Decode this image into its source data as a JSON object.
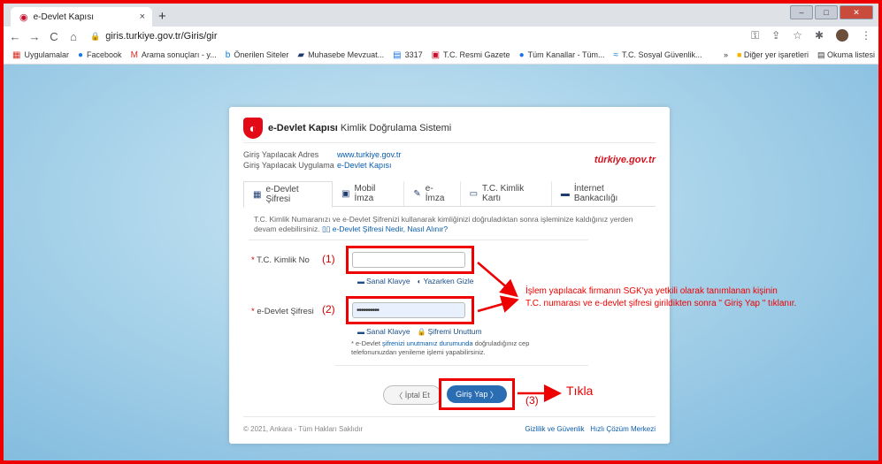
{
  "browser": {
    "tab_title": "e-Devlet Kapısı",
    "tab_close": "×",
    "new_tab": "+",
    "url": "giris.turkiye.gov.tr/Giris/gir",
    "nav": {
      "back": "←",
      "forward": "→",
      "reload": "C",
      "home": "⌂"
    }
  },
  "bookmarks": {
    "items": [
      {
        "label": "Uygulamalar",
        "icon": "apps-icon"
      },
      {
        "label": "Facebook",
        "icon": "facebook-icon"
      },
      {
        "label": "Arama sonuçları - y...",
        "icon": "gmail-icon"
      },
      {
        "label": "Önerilen Siteler",
        "icon": "bing-icon"
      },
      {
        "label": "Muhasebe Mevzuat...",
        "icon": "mm-icon"
      },
      {
        "label": "3317",
        "icon": "doc-icon"
      },
      {
        "label": "T.C. Resmi Gazete",
        "icon": "gazette-icon"
      },
      {
        "label": "Tüm Kanallar - Tüm...",
        "icon": "channel-icon"
      },
      {
        "label": "T.C. Sosyal Güvenlik...",
        "icon": "sgk-icon"
      }
    ],
    "more": "»",
    "other": "Diğer yer işaretleri",
    "reading": "Okuma listesi"
  },
  "card": {
    "header_bold": "e-Devlet Kapısı",
    "header_rest": " Kimlik Doğrulama Sistemi",
    "info": [
      {
        "label": "Giriş Yapılacak Adres",
        "value": "www.turkiye.gov.tr"
      },
      {
        "label": "Giriş Yapılacak Uygulama",
        "value": "e-Devlet Kapısı"
      }
    ],
    "brand": "türkiye.gov.tr",
    "tabs": [
      {
        "label": "e-Devlet Şifresi",
        "icon": "▦",
        "active": true
      },
      {
        "label": "Mobil İmza",
        "icon": "▣",
        "active": false
      },
      {
        "label": "e-İmza",
        "icon": "✎",
        "active": false
      },
      {
        "label": "T.C. Kimlik Kartı",
        "icon": "▭",
        "active": false
      },
      {
        "label": "İnternet Bankacılığı",
        "icon": "▬",
        "active": false
      }
    ],
    "desc_text": "T.C. Kimlik Numaranızı ve e-Devlet Şifrenizi kullanarak kimliğinizi doğruladıktan sonra işleminize kaldığınız yerden devam edebilirsiniz.",
    "desc_link": "e-Devlet Şifresi Nedir, Nasıl Alınır?",
    "tc_label": "T.C. Kimlik No",
    "tc_value": "",
    "tc_sub1": "Sanal Klavye",
    "tc_sub2": "Yazarken Gizle",
    "pw_label": "e-Devlet Şifresi",
    "pw_value": "••••••••••",
    "pw_sub1": "Sanal Klavye",
    "pw_sub2": "Şifremi Unuttum",
    "note_pre": "* e-Devlet ",
    "note_link": "şifrenizi unutmanız durumunda",
    "note_post": " doğruladığınız cep telefonunuzdan yenileme işlemi yapabilirsiniz.",
    "cancel": "İptal Et",
    "login": "Giriş Yap",
    "footer_left": "© 2021, Ankara - Tüm Hakları Saklıdır",
    "footer_right1": "Gizlilik ve Güvenlik",
    "footer_right2": "Hızlı Çözüm Merkezi"
  },
  "annotations": {
    "n1": "(1)",
    "n2": "(2)",
    "n3": "(3)",
    "instruction_line1": "İşlem yapılacak firmanın SGK'ya yetkili olarak tanımlanan kişinin",
    "instruction_line2": "T.C. numarası ve e-devlet şifresi girildikten sonra \" Giriş Yap \" tıklanır.",
    "tikla": "Tıkla",
    "color": "#e00000"
  }
}
